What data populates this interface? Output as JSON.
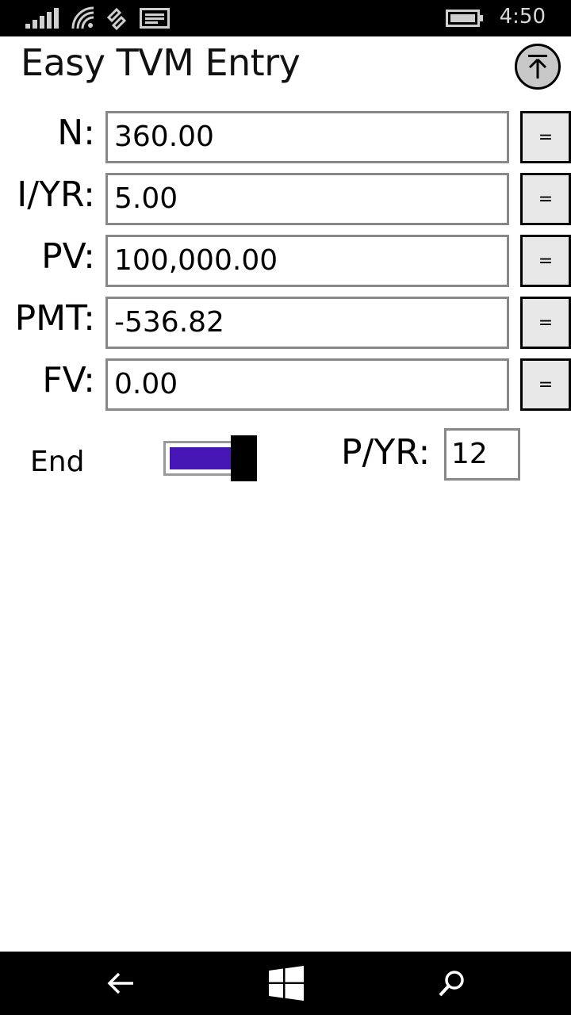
{
  "status_bar": {
    "time": "4:50"
  },
  "header": {
    "title": "Easy TVM Entry"
  },
  "fields": [
    {
      "label": "N:",
      "value": "360.00",
      "button": "="
    },
    {
      "label": "I/YR:",
      "value": "5.00",
      "button": "="
    },
    {
      "label": "PV:",
      "value": "100,000.00",
      "button": "="
    },
    {
      "label": "PMT:",
      "value": "-536.82",
      "button": "="
    },
    {
      "label": "FV:",
      "value": "0.00",
      "button": "="
    }
  ],
  "payment_timing": {
    "label": "End",
    "toggle_on": true,
    "accent_color": "#4617b4"
  },
  "pyr": {
    "label": "P/YR:",
    "value": "12"
  },
  "icons": [
    "signal-icon",
    "wifi-icon",
    "cellular-data-icon",
    "message-icon",
    "battery-icon",
    "arrow-up-to-top-icon",
    "back-arrow-icon",
    "windows-icon",
    "search-icon"
  ]
}
